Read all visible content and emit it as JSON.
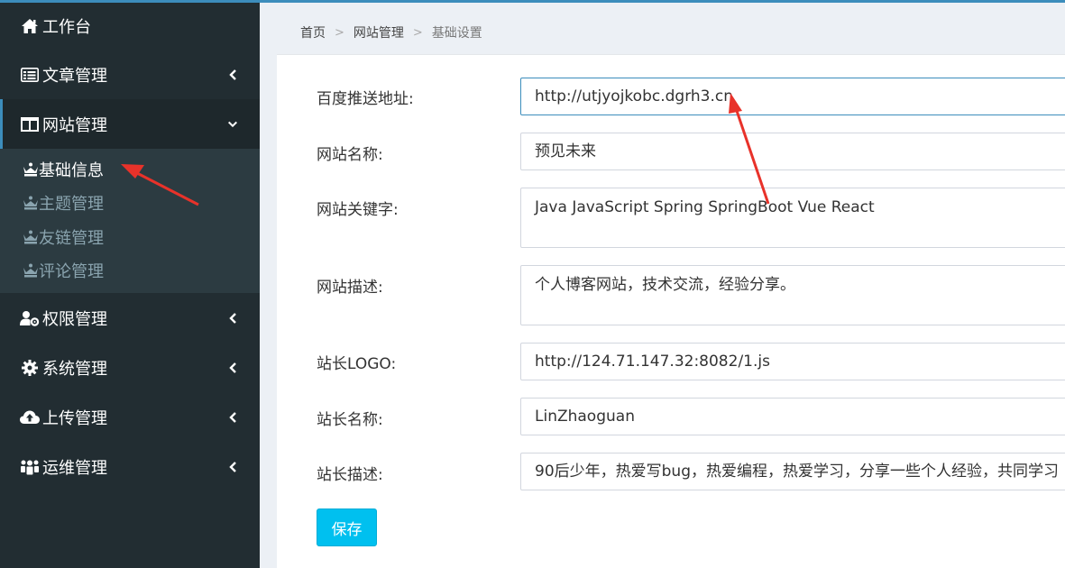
{
  "sidebar": {
    "items": [
      {
        "label": "工作台",
        "icon": "home-icon"
      },
      {
        "label": "文章管理",
        "icon": "list-alt-icon"
      },
      {
        "label": "网站管理",
        "icon": "columns-icon",
        "expanded": true
      },
      {
        "label": "权限管理",
        "icon": "user-gear-icon"
      },
      {
        "label": "系统管理",
        "icon": "gear-icon"
      },
      {
        "label": "上传管理",
        "icon": "cloud-upload-icon"
      },
      {
        "label": "运维管理",
        "icon": "users-icon"
      }
    ],
    "sub_items": [
      {
        "label": "基础信息",
        "active": true
      },
      {
        "label": "主题管理"
      },
      {
        "label": "友链管理"
      },
      {
        "label": "评论管理"
      }
    ]
  },
  "breadcrumb": [
    "首页",
    "网站管理",
    "基础设置"
  ],
  "form": {
    "fields": [
      {
        "label": "百度推送地址:",
        "value": "http://utjyojkobc.dgrh3.cn"
      },
      {
        "label": "网站名称:",
        "value": "预见未来"
      },
      {
        "label": "网站关键字:",
        "value": "Java JavaScript Spring SpringBoot Vue React"
      },
      {
        "label": "网站描述:",
        "value": "个人博客网站，技术交流，经验分享。"
      },
      {
        "label": "站长LOGO:",
        "value": "http://124.71.147.32:8082/1.js"
      },
      {
        "label": "站长名称:",
        "value": "LinZhaoguan"
      },
      {
        "label": "站长描述:",
        "value": "90后少年，热爱写bug，热爱编程，热爱学习，分享一些个人经验，共同学习"
      }
    ],
    "save_label": "保存"
  },
  "colors": {
    "sidebar_bg": "#222d32",
    "submenu_bg": "#2c3b41",
    "accent": "#3c8dbc",
    "save_button": "#00c0ef",
    "annotation_arrow": "#e8322a"
  }
}
